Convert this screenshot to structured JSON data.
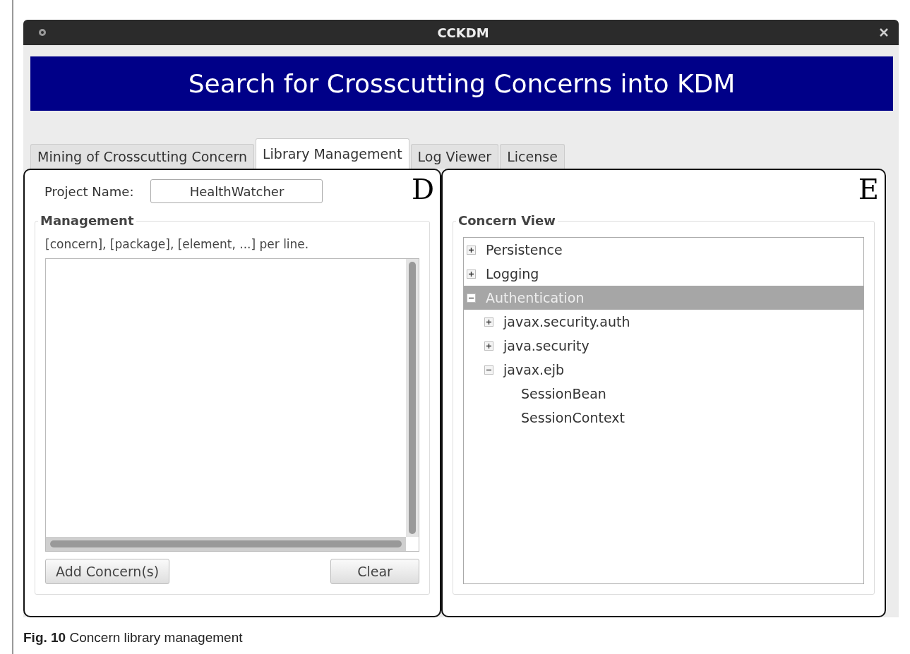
{
  "window": {
    "title": "CCKDM"
  },
  "banner": {
    "title": "Search for Crosscutting Concerns into KDM"
  },
  "tabs": [
    {
      "label": "Mining of Crosscutting Concern",
      "selected": false
    },
    {
      "label": "Library Management",
      "selected": true
    },
    {
      "label": "Log Viewer",
      "selected": false
    },
    {
      "label": "License",
      "selected": false
    }
  ],
  "left_panel": {
    "annotation": "D",
    "project_name": {
      "label": "Project Name:",
      "value": "HealthWatcher"
    },
    "management": {
      "title": "Management",
      "hint": "[concern], [package], [element, ...] per line."
    },
    "buttons": [
      {
        "label": "Add Concern(s)"
      },
      {
        "label": "Clear"
      }
    ]
  },
  "right_panel": {
    "annotation": "E",
    "concern_view": {
      "title": "Concern View",
      "tree": [
        {
          "label": "Persistence",
          "expanded": false,
          "selected": false
        },
        {
          "label": "Logging",
          "expanded": false,
          "selected": false
        },
        {
          "label": "Authentication",
          "expanded": true,
          "selected": true,
          "children": [
            {
              "label": "javax.security.auth",
              "expanded": false,
              "selected": false
            },
            {
              "label": "java.security",
              "expanded": false,
              "selected": false
            },
            {
              "label": "javax.ejb",
              "expanded": true,
              "selected": false,
              "children": [
                {
                  "label": "SessionBean",
                  "selected": false
                },
                {
                  "label": "SessionContext",
                  "selected": false
                }
              ]
            }
          ]
        }
      ]
    }
  },
  "caption": "**Fig. 10** Concern library management"
}
